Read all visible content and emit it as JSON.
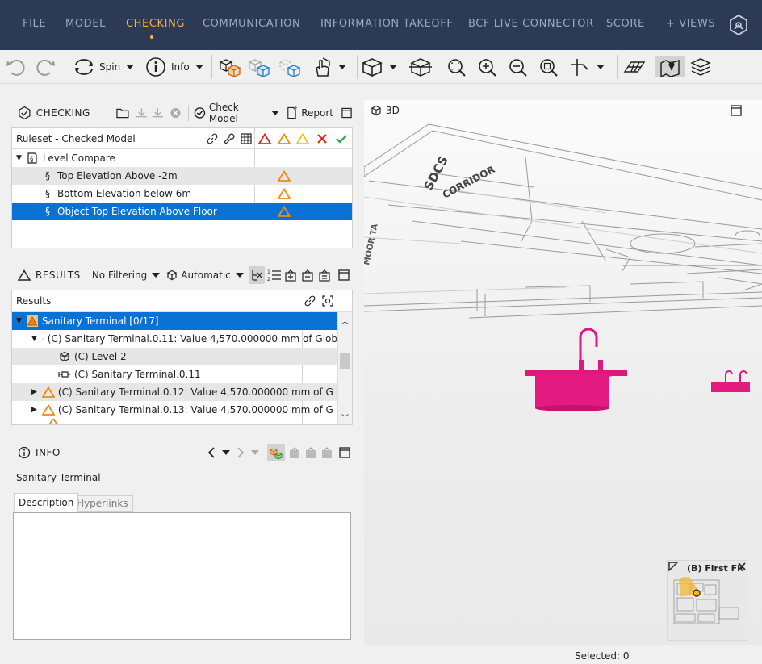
{
  "menu": {
    "items": [
      "FILE",
      "MODEL",
      "CHECKING",
      "COMMUNICATION",
      "INFORMATION TAKEOFF",
      "BCF LIVE CONNECTOR",
      "SCORE"
    ],
    "views_label": "+ VIEWS",
    "accent_color": "#f5b629",
    "bg_color": "#2d3a56"
  },
  "toolbar": {
    "spin_label": "Spin",
    "info_label": "Info"
  },
  "checking": {
    "title": "CHECKING",
    "check_model_label": "Check Model",
    "report_label": "Report",
    "column_header": "Ruleset - Checked Model",
    "ruleset_name": "Level Compare",
    "rules": [
      "Top Elevation Above -2m",
      "Bottom Elevation below 6m",
      "Object Top Elevation Above Floor"
    ]
  },
  "results": {
    "title": "RESULTS",
    "filter_label": "No Filtering",
    "mode_label": "Automatic",
    "column_header": "Results",
    "group_label": "Sanitary Terminal [0/17]",
    "items": [
      "(C) Sanitary Terminal.0.11: Value 4,570.000000 mm of Glob",
      "(C) Level 2",
      "(C) Sanitary Terminal.0.11",
      "(C) Sanitary Terminal.0.12: Value 4,570.000000 mm of G",
      "(C) Sanitary Terminal.0.13: Value 4,570.000000 mm of G"
    ]
  },
  "info": {
    "title": "INFO",
    "object_name": "Sanitary Terminal",
    "tabs": [
      "Description",
      "Hyperlinks"
    ]
  },
  "viewport": {
    "label": "3D",
    "room_text_1": "SDCS",
    "room_text_2": "CORRIDOR",
    "room_text_3": "MOOR TA"
  },
  "minimap": {
    "label": "(B) First Floor"
  },
  "status": {
    "selected": "Selected: 0"
  }
}
